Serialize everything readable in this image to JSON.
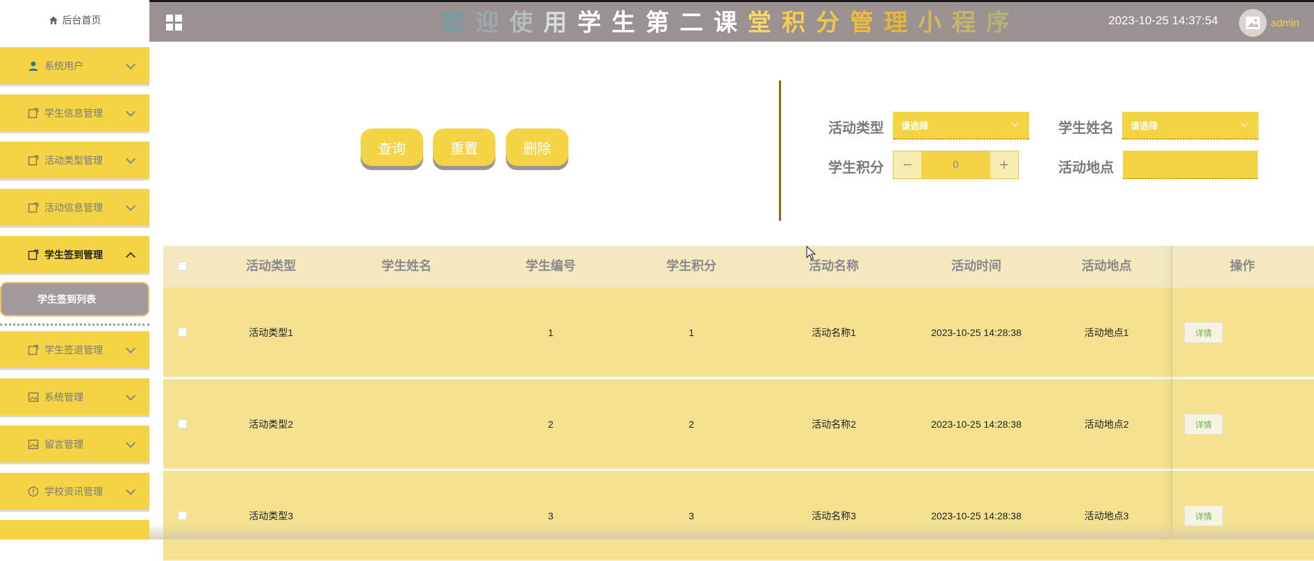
{
  "header": {
    "title": "欢迎使用学生第二课堂积分管理小程序",
    "title_colors": [
      "#6f9fa8",
      "#9aa9b0",
      "#b4bdc0",
      "#d7dbdc",
      "#ffffff",
      "#ffffff",
      "#ffffff",
      "#ffffff",
      "#ffffff",
      "#f9d868",
      "#f3cd55",
      "#efc646",
      "#ecbe3c",
      "#e6b53c",
      "#d8b45a",
      "#c7b668",
      "#b2b274",
      "#9c9f6f"
    ],
    "datetime": "2023-10-25 14:37:54",
    "username": "admin"
  },
  "sidebar": {
    "home_label": "后台首页",
    "items": [
      {
        "label": "系统用户",
        "icon": "user-icon"
      },
      {
        "label": "学生信息管理",
        "icon": "edit-icon"
      },
      {
        "label": "活动类型管理",
        "icon": "edit-icon"
      },
      {
        "label": "活动信息管理",
        "icon": "edit-icon"
      },
      {
        "label": "学生签到管理",
        "icon": "edit-icon",
        "expanded": true
      },
      {
        "label": "学生签退管理",
        "icon": "edit-icon"
      },
      {
        "label": "系统管理",
        "icon": "image-icon"
      },
      {
        "label": "留言管理",
        "icon": "image-icon"
      },
      {
        "label": "学校资讯管理",
        "icon": "info-icon"
      }
    ],
    "submenu_label": "学生签到列表"
  },
  "search": {
    "query_label": "查询",
    "reset_label": "重置",
    "delete_label": "删除",
    "activity_type_label": "活动类型",
    "activity_type_value": "请选择",
    "student_name_label": "学生姓名",
    "student_name_value": "请选择",
    "points_label": "学生积分",
    "points_value": "0",
    "minus": "−",
    "plus": "+",
    "place_label": "活动地点",
    "place_value": ""
  },
  "table": {
    "columns": [
      "活动类型",
      "学生姓名",
      "学生编号",
      "学生积分",
      "活动名称",
      "活动时间",
      "活动地点",
      "操作"
    ],
    "detail_label": "详情",
    "rows": [
      {
        "type": "活动类型1",
        "name": "",
        "no": "1",
        "points": "1",
        "activity": "活动名称1",
        "time": "2023-10-25 14:28:38",
        "place": "活动地点1"
      },
      {
        "type": "活动类型2",
        "name": "",
        "no": "2",
        "points": "2",
        "activity": "活动名称2",
        "time": "2023-10-25 14:28:38",
        "place": "活动地点2"
      },
      {
        "type": "活动类型3",
        "name": "",
        "no": "3",
        "points": "3",
        "activity": "活动名称3",
        "time": "2023-10-25 14:28:38",
        "place": "活动地点3"
      }
    ]
  },
  "colors": {
    "accent": "#f4d444",
    "header_bg": "#9a9191",
    "row_bg": "#f4e291",
    "thead_bg": "#f3e8c0"
  }
}
